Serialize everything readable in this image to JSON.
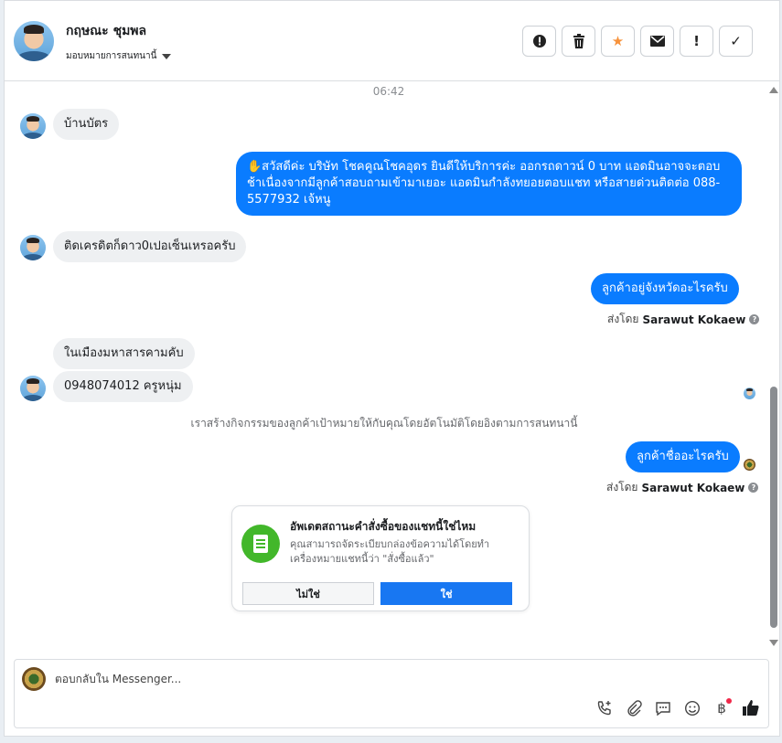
{
  "header": {
    "contact_name": "กฤษณะ ชุมพล",
    "assign_label": "มอบหมายการสนทนานี้",
    "actions": [
      {
        "name": "spam-report-button",
        "icon": "exclamation-circle-icon",
        "glyph": "!"
      },
      {
        "name": "delete-button",
        "icon": "trash-icon",
        "glyph": "🗑"
      },
      {
        "name": "star-button",
        "icon": "star-icon",
        "glyph": "★"
      },
      {
        "name": "mark-unread-button",
        "icon": "envelope-icon",
        "glyph": "✉"
      },
      {
        "name": "follow-up-button",
        "icon": "exclamation-icon",
        "glyph": "!"
      },
      {
        "name": "mark-done-button",
        "icon": "checkmark-icon",
        "glyph": "✓"
      }
    ]
  },
  "conversation": {
    "timestamp": "06:42",
    "messages": {
      "m1": "บ้านบัตร",
      "m2": "✋สวัสดีค่ะ บริษัท โชคคูณโชคอุดร ยินดีให้บริการค่ะ ออกรถดาวน์ 0 บาท แอดมินอาจจะตอบช้าเนื่องจากมีลูกค้าสอบถามเข้ามาเยอะ แอดมินกำลังทยอยตอบแชท หรือสายด่วนติดต่อ 088-5577932 เจ้หนู",
      "m3": "ติดเครดิตก็ดาว0เปอเซ็นเหรอครับ",
      "m4": "ลูกค้าอยู่จังหวัดอะไรครับ",
      "m5": "ในเมืองมหาสารคามคับ",
      "m6": "0948074012 ครูหนุ่ม",
      "m7": "ลูกค้าชื่ออะไรครับ"
    },
    "sent_by_prefix": "ส่งโดย",
    "sent_by_name": "Sarawut Kokaew",
    "system_note": "เราสร้างกิจกรรมของลูกค้าเป้าหมายให้กับคุณโดยอัตโนมัติโดยอิงตามการสนทนานี้",
    "order_card": {
      "title": "อัพเดตสถานะคำสั่งซื้อของแชทนี้ใช่ไหม",
      "description": "คุณสามารถจัดระเบียบกล่องข้อความได้โดยทำเครื่องหมายแชทนี้ว่า \"สั่งซื้อแล้ว\"",
      "no_label": "ไม่ใช่",
      "yes_label": "ใช่"
    }
  },
  "composer": {
    "placeholder": "ตอบกลับใน Messenger...",
    "tools": [
      "phone-plus-icon",
      "attachment-icon",
      "saved-replies-icon",
      "emoji-icon",
      "baht-payment-icon",
      "thumbs-up-icon"
    ]
  },
  "colors": {
    "outgoing_bubble": "#0a7cff",
    "incoming_bubble": "#eef0f2",
    "primary_button": "#1877f2",
    "star": "#f7923b",
    "card_icon_bg": "#42b72a"
  }
}
